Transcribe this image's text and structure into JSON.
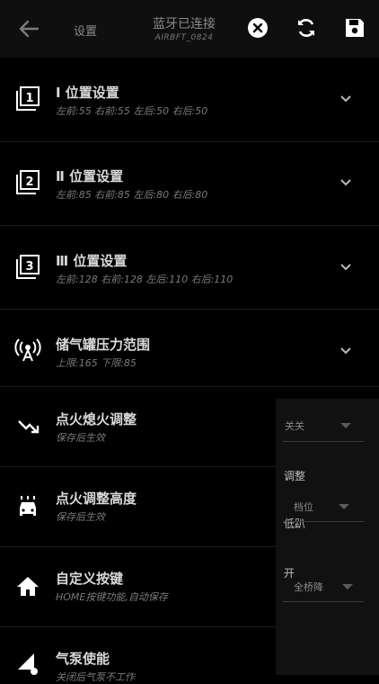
{
  "header": {
    "page_label": "设置",
    "bt_status": "蓝牙已连接",
    "device_name": "AIRBFT_0824"
  },
  "rows": [
    {
      "title": "Ⅰ 位置设置",
      "sub": "左前:55 右前:55 左后:50 右后:50",
      "icon": "position-1-icon"
    },
    {
      "title": "Ⅱ 位置设置",
      "sub": "左前:85 右前:85 左后:80 右后:80",
      "icon": "position-2-icon"
    },
    {
      "title": "Ⅲ 位置设置",
      "sub": "左前:128 右前:128 左后:110 右后:110",
      "icon": "position-3-icon"
    },
    {
      "title": "储气罐压力范围",
      "sub": "上限:165 下限:85",
      "icon": "tank-pressure-icon"
    },
    {
      "title": "点火熄火调整",
      "sub": "保存后生效",
      "icon": "ignition-icon"
    },
    {
      "title": "点火调整高度",
      "sub": "保存后生效",
      "icon": "car-height-icon"
    },
    {
      "title": "自定义按键",
      "sub": "HOME按键功能,自动保存",
      "icon": "home-icon"
    },
    {
      "title": "气泵使能",
      "sub": "关闭后气泵不工作",
      "icon": "pump-icon"
    }
  ],
  "side_menu": {
    "ignition_value": "关关",
    "adjust_label": "调整",
    "level_value": "档位",
    "low_label": "低趴",
    "open_label": "开",
    "bridge_value": "全桥降"
  },
  "pump_enabled": true
}
